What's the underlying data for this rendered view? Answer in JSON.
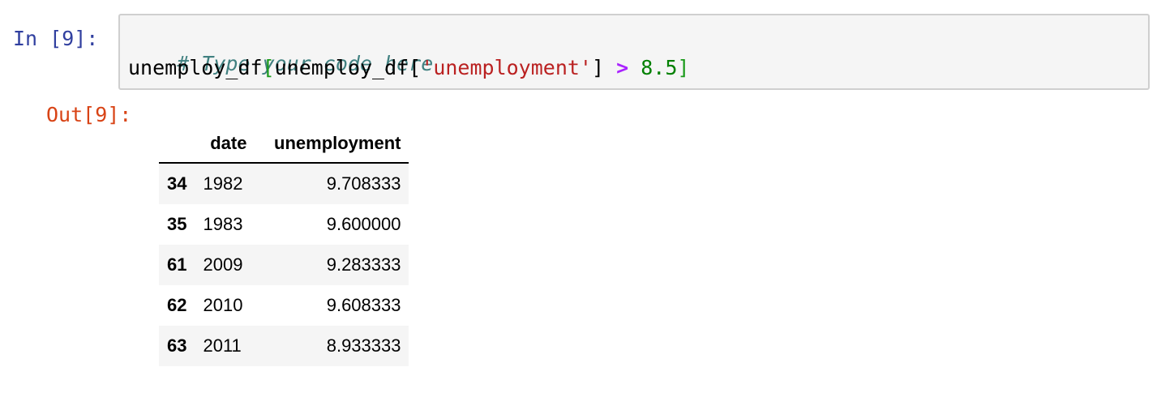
{
  "input_cell": {
    "prompt": "In [9]:",
    "code_comment": "# Type your code here",
    "code_tokens": {
      "t1": "unemploy_df",
      "t2": "[",
      "t3": "unemploy_df[",
      "t4": "'unemployment'",
      "t5": "] ",
      "t6": ">",
      "t7": " ",
      "t8": "8.5",
      "t9": "]"
    }
  },
  "output_cell": {
    "prompt": "Out[9]:",
    "table": {
      "index_header": "",
      "columns": [
        "date",
        "unemployment"
      ],
      "rows": [
        {
          "index": "34",
          "date": "1982",
          "unemployment": "9.708333"
        },
        {
          "index": "35",
          "date": "1983",
          "unemployment": "9.600000"
        },
        {
          "index": "61",
          "date": "2009",
          "unemployment": "9.283333"
        },
        {
          "index": "62",
          "date": "2010",
          "unemployment": "9.608333"
        },
        {
          "index": "63",
          "date": "2011",
          "unemployment": "8.933333"
        }
      ]
    }
  },
  "colors": {
    "in_prompt": "#303f9f",
    "out_prompt": "#d84315",
    "cell_background": "#f5f5f5",
    "comment": "#408080",
    "string": "#ba2121",
    "operator": "#aa22ff",
    "number": "#008000"
  }
}
